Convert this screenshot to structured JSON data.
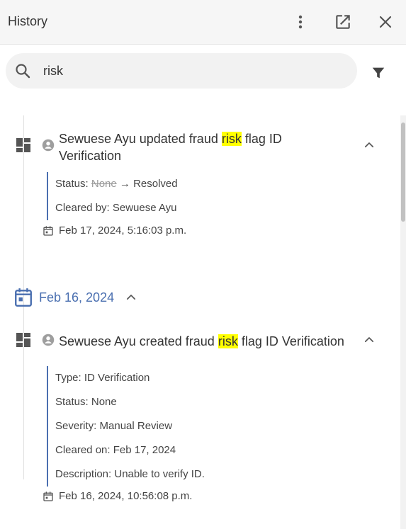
{
  "header": {
    "title": "History",
    "more_icon": "more-vert-icon",
    "open_icon": "open-in-new-icon",
    "close_icon": "close-icon"
  },
  "search": {
    "value": "risk",
    "placeholder": "",
    "icon": "search-icon",
    "filter_icon": "filter-icon"
  },
  "events": [
    {
      "icon": "dashboard-icon",
      "user_icon": "account-circle-icon",
      "title_before": "Sewuese Ayu updated fraud ",
      "title_highlight": "risk",
      "title_after": " flag ID Verification",
      "details": {
        "status_label": "Status: ",
        "status_old": "None",
        "status_arrow": " → ",
        "status_new": "Resolved",
        "cleared_by": "Cleared by: Sewuese Ayu"
      },
      "timestamp": "Feb 17, 2024, 5:16:03 p.m."
    },
    {
      "icon": "dashboard-icon",
      "user_icon": "account-circle-icon",
      "title_before": "Sewuese Ayu created fraud ",
      "title_highlight": "risk",
      "title_after": " flag ID Verification",
      "details": {
        "type": "Type: ID Verification",
        "status": "Status: None",
        "severity": "Severity: Manual Review",
        "cleared_on": "Cleared on: Feb 17, 2024",
        "description": "Description: Unable to verify ID."
      },
      "timestamp": "Feb 16, 2024, 10:56:08 p.m."
    }
  ],
  "date_group": {
    "label": "Feb 16, 2024",
    "icon": "calendar-icon"
  },
  "colors": {
    "accent": "#4a6fb0",
    "highlight": "#ffff00",
    "header_bg": "#f6f6f6",
    "search_bg": "#f2f2f2"
  }
}
